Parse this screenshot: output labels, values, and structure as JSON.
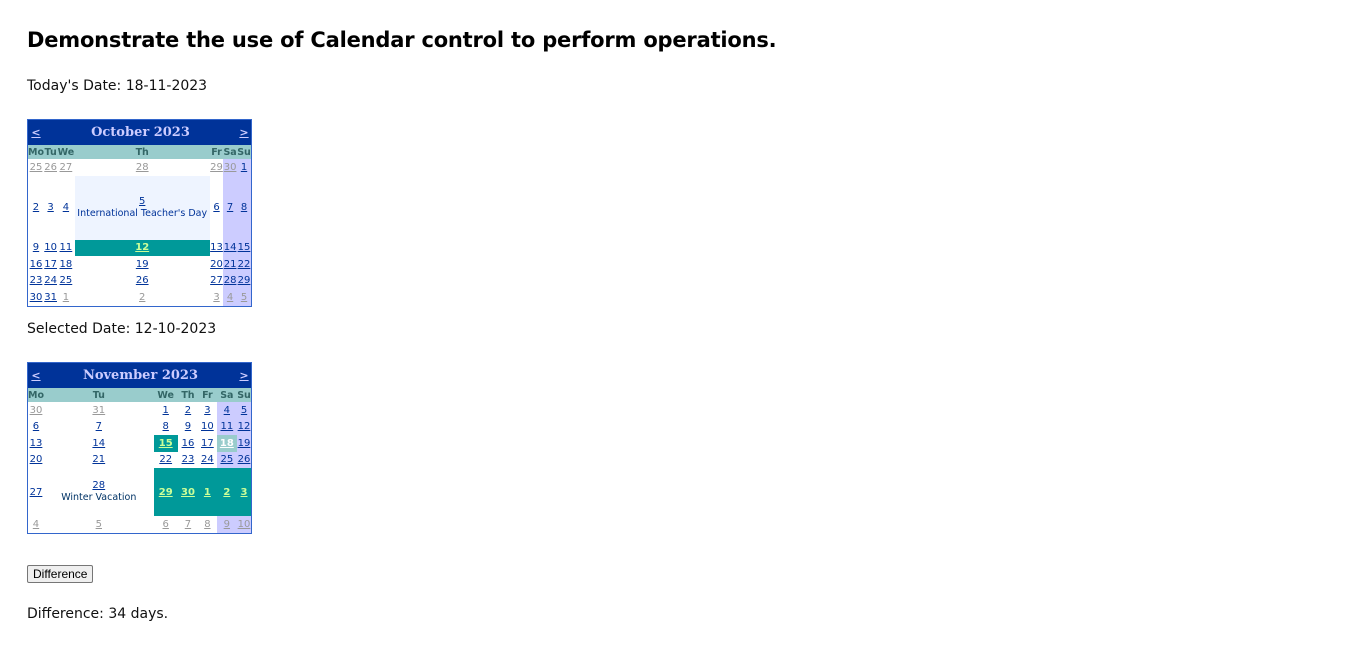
{
  "heading": "Demonstrate the use of Calendar control to perform operations.",
  "today_label": "Today's Date: 18-11-2023",
  "selected_label": "Selected Date: 12-10-2023",
  "difference_button": "Difference",
  "difference_result": "Difference: 34 days.",
  "colors": {
    "header_bg": "#003399",
    "header_text": "#ccccff",
    "dow_bg": "#99cccc",
    "weekend_bg": "#ccccff",
    "selected_bg": "#009999",
    "selected_text": "#ccff99",
    "today_bg": "#99cccc",
    "link": "#003399",
    "other_month": "#999999"
  },
  "calendars": [
    {
      "title": "October 2023",
      "prev": "<",
      "next": ">",
      "days_of_week": [
        "Mo",
        "Tu",
        "We",
        "Th",
        "Fr",
        "Sa",
        "Su"
      ],
      "weeks": [
        [
          {
            "d": "25",
            "other": true
          },
          {
            "d": "26",
            "other": true
          },
          {
            "d": "27",
            "other": true
          },
          {
            "d": "28",
            "other": true
          },
          {
            "d": "29",
            "other": true
          },
          {
            "d": "30",
            "other": true,
            "weekend": true
          },
          {
            "d": "1",
            "weekend": true
          }
        ],
        [
          {
            "d": "2"
          },
          {
            "d": "3"
          },
          {
            "d": "4"
          },
          {
            "d": "5",
            "note": "International Teacher's Day"
          },
          {
            "d": "6"
          },
          {
            "d": "7",
            "weekend": true
          },
          {
            "d": "8",
            "weekend": true
          }
        ],
        [
          {
            "d": "9"
          },
          {
            "d": "10"
          },
          {
            "d": "11"
          },
          {
            "d": "12",
            "selected": true
          },
          {
            "d": "13"
          },
          {
            "d": "14",
            "weekend": true
          },
          {
            "d": "15",
            "weekend": true
          }
        ],
        [
          {
            "d": "16"
          },
          {
            "d": "17"
          },
          {
            "d": "18"
          },
          {
            "d": "19"
          },
          {
            "d": "20"
          },
          {
            "d": "21",
            "weekend": true
          },
          {
            "d": "22",
            "weekend": true
          }
        ],
        [
          {
            "d": "23"
          },
          {
            "d": "24"
          },
          {
            "d": "25"
          },
          {
            "d": "26"
          },
          {
            "d": "27"
          },
          {
            "d": "28",
            "weekend": true
          },
          {
            "d": "29",
            "weekend": true
          }
        ],
        [
          {
            "d": "30"
          },
          {
            "d": "31"
          },
          {
            "d": "1",
            "other": true
          },
          {
            "d": "2",
            "other": true
          },
          {
            "d": "3",
            "other": true
          },
          {
            "d": "4",
            "other": true,
            "weekend": true
          },
          {
            "d": "5",
            "other": true,
            "weekend": true
          }
        ]
      ]
    },
    {
      "title": "November 2023",
      "prev": "<",
      "next": ">",
      "days_of_week": [
        "Mo",
        "Tu",
        "We",
        "Th",
        "Fr",
        "Sa",
        "Su"
      ],
      "weeks": [
        [
          {
            "d": "30",
            "other": true
          },
          {
            "d": "31",
            "other": true
          },
          {
            "d": "1"
          },
          {
            "d": "2"
          },
          {
            "d": "3"
          },
          {
            "d": "4",
            "weekend": true
          },
          {
            "d": "5",
            "weekend": true
          }
        ],
        [
          {
            "d": "6"
          },
          {
            "d": "7"
          },
          {
            "d": "8"
          },
          {
            "d": "9"
          },
          {
            "d": "10"
          },
          {
            "d": "11",
            "weekend": true
          },
          {
            "d": "12",
            "weekend": true
          }
        ],
        [
          {
            "d": "13"
          },
          {
            "d": "14"
          },
          {
            "d": "15",
            "selected": true
          },
          {
            "d": "16"
          },
          {
            "d": "17"
          },
          {
            "d": "18",
            "today": true
          },
          {
            "d": "19",
            "weekend": true
          }
        ],
        [
          {
            "d": "20"
          },
          {
            "d": "21"
          },
          {
            "d": "22"
          },
          {
            "d": "23"
          },
          {
            "d": "24"
          },
          {
            "d": "25",
            "weekend": true
          },
          {
            "d": "26",
            "weekend": true
          }
        ],
        [
          {
            "d": "27"
          },
          {
            "d": "28",
            "note": "Winter Vacation"
          },
          {
            "d": "29",
            "selected": true
          },
          {
            "d": "30",
            "selected": true
          },
          {
            "d": "1",
            "selected": true
          },
          {
            "d": "2",
            "selected": true
          },
          {
            "d": "3",
            "selected": true
          }
        ],
        [
          {
            "d": "4",
            "other": true
          },
          {
            "d": "5",
            "other": true
          },
          {
            "d": "6",
            "other": true
          },
          {
            "d": "7",
            "other": true
          },
          {
            "d": "8",
            "other": true
          },
          {
            "d": "9",
            "other": true,
            "weekend": true
          },
          {
            "d": "10",
            "other": true,
            "weekend": true
          }
        ]
      ]
    }
  ]
}
